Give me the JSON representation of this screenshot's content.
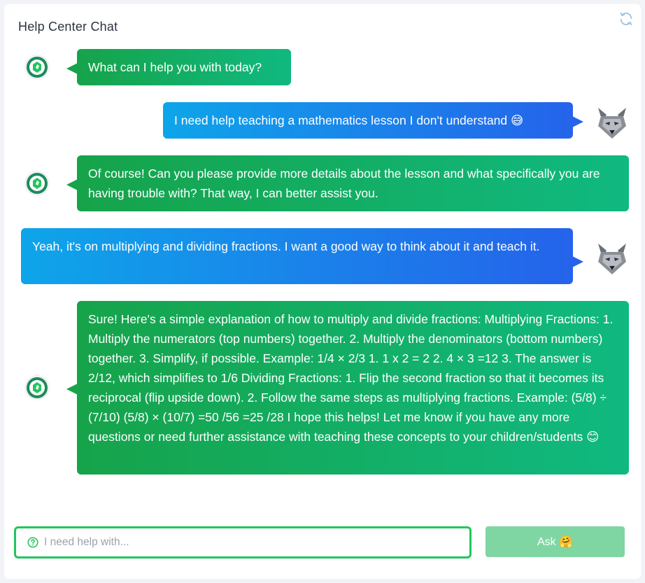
{
  "header": {
    "title": "Help Center Chat",
    "refresh_icon": "refresh-icon"
  },
  "messages": [
    {
      "sender": "bot",
      "text": "What can I help you with today?"
    },
    {
      "sender": "user",
      "text": "I need help teaching a mathematics lesson I don't understand 😅"
    },
    {
      "sender": "bot",
      "text": "Of course! Can you please provide more details about the lesson and what specifically you are having trouble with? That way, I can better assist you."
    },
    {
      "sender": "user",
      "text": "Yeah, it's on multiplying and dividing fractions. I want a good way to think about it and teach it."
    },
    {
      "sender": "bot",
      "text": "Sure! Here's a simple explanation of how to multiply and divide fractions: Multiplying Fractions: 1. Multiply the numerators (top numbers) together. 2. Multiply the denominators (bottom numbers) together. 3. Simplify, if possible. Example: 1/4 × 2/3 1. 1 x 2 = 2 2. 4 × 3 =12 3. The answer is 2/12, which simplifies to 1/6 Dividing Fractions: 1. Flip the second fraction so that it becomes its reciprocal (flip upside down). 2. Follow the same steps as multiplying fractions. Example: (5/8) ÷ (7/10) (5/8) × (10/7) =50 /56 =25 /28 I hope this helps! Let me know if you have any more questions or need further assistance with teaching these concepts to your children/students 😊"
    }
  ],
  "composer": {
    "placeholder": "I need help with...",
    "help_icon": "question-circle-icon",
    "ask_label": "Ask 🤗"
  },
  "colors": {
    "bot_bubble": "#16a34a",
    "user_bubble": "#2563eb",
    "input_border": "#22c55e",
    "ask_button": "#7fd6a2"
  }
}
